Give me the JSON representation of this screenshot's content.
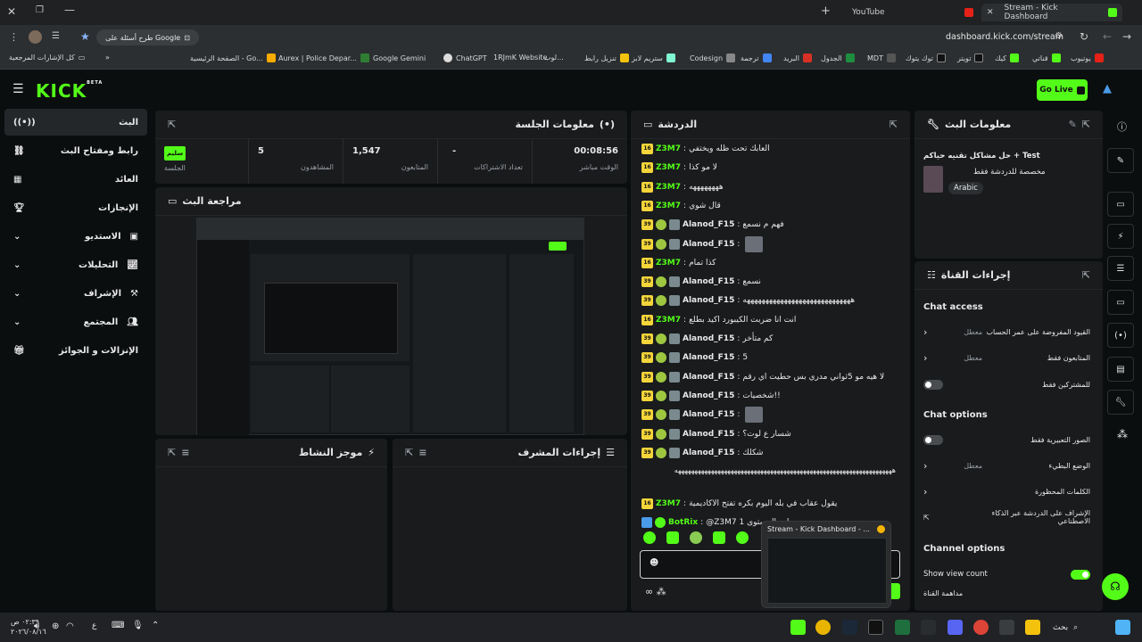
{
  "browser": {
    "tabs": [
      {
        "title": "YouTube"
      },
      {
        "title": "Stream - Kick Dashboard"
      }
    ],
    "url": "dashboard.kick.com/stream",
    "google_chip": "طرح أسئلة على Google",
    "bookmarks": [
      "يوتيوب",
      "قناتي",
      "كيك",
      "تويتر",
      "توك يتوك",
      "MDT",
      "الجدول",
      "البريد",
      "ترجمة",
      "Codesign",
      "ستريم لابز",
      "تنزيل رابط",
      "لوب...",
      "1RJmK Website",
      "ChatGPT",
      "Google Gemini",
      "Aurex | Police Depar...",
      "الصفحة الرئيسية - Go...",
      "كل الإشارات المرجعية"
    ],
    "colors": {
      "accent": "#53fc18"
    }
  },
  "kick": {
    "logo": "KICK",
    "logo_sup": "BETA",
    "go_live": "Go Live"
  },
  "sidebar": {
    "items": [
      {
        "label": "البث"
      },
      {
        "label": "رابط ومفتاح البث"
      },
      {
        "label": "العائد"
      },
      {
        "label": "الإنجازات"
      },
      {
        "label": "الاستديو"
      },
      {
        "label": "التحليلات"
      },
      {
        "label": "الإشراف"
      },
      {
        "label": "المجتمع"
      },
      {
        "label": "الإنزالات و الجوائز"
      }
    ]
  },
  "session": {
    "title": "معلومات الجلسة",
    "stats": [
      {
        "value": "00:08:56",
        "label": "الوقت مباشر"
      },
      {
        "value": "-",
        "label": "تعداد الاشتراكات"
      },
      {
        "value": "1,547",
        "label": "المتابعون"
      },
      {
        "value": "5",
        "label": "المشاهدون"
      },
      {
        "value": "سليم",
        "label": "الجلسة"
      }
    ]
  },
  "preview": {
    "title": "مراجعة البث"
  },
  "activity": {
    "title": "موجز النشاط"
  },
  "modactions": {
    "title": "إجراءات المشرف"
  },
  "chat": {
    "title": "الدردشة",
    "messages": [
      {
        "user": "Z3M7",
        "text": "العابك تحت ظله ويختفي",
        "kind": "z"
      },
      {
        "user": "Z3M7",
        "text": "لا مو كذا",
        "kind": "z"
      },
      {
        "user": "Z3M7",
        "text": "ههههههههه",
        "kind": "z"
      },
      {
        "user": "Z3M7",
        "text": "قال شوي",
        "kind": "z"
      },
      {
        "user": "Alanod_F15",
        "text": "فهم م نسمع",
        "kind": "a"
      },
      {
        "user": "Alanod_F15",
        "text": "",
        "kind": "a"
      },
      {
        "user": "Z3M7",
        "text": "كذا تمام",
        "kind": "z"
      },
      {
        "user": "Alanod_F15",
        "text": "نسمع",
        "kind": "a"
      },
      {
        "user": "Alanod_F15",
        "text": "هههههههههههههههههههههههههههههه",
        "kind": "a"
      },
      {
        "user": "Z3M7",
        "text": "انت انا ضربت الكيبورد اكيد بطلع",
        "kind": "z"
      },
      {
        "user": "Alanod_F15",
        "text": "كم متأخر",
        "kind": "a"
      },
      {
        "user": "Alanod_F15",
        "text": "5",
        "kind": "a"
      },
      {
        "user": "Alanod_F15",
        "text": "لا هيه مو 5ثواني مدري بس حطيت اي رقم",
        "kind": "a"
      },
      {
        "user": "Alanod_F15",
        "text": "شخصيات!!",
        "kind": "a"
      },
      {
        "user": "Alanod_F15",
        "text": "",
        "kind": "a"
      },
      {
        "user": "Alanod_F15",
        "text": "شسار ع لوت؟",
        "kind": "a"
      },
      {
        "user": "Alanod_F15",
        "text": "شكلك",
        "kind": "a"
      }
    ],
    "long_line": "ههههههههههههههههههههههههههههههههههههههههههههههههههههههههههههههههههه",
    "last_z": {
      "user": "Z3M7",
      "text": "يقول عقاب في بله اليوم بكره تفتح الاكاديمية"
    },
    "bot": {
      "user": "BotRix",
      "text": "@Z3M7 وصلت المستوى 1"
    },
    "hover_title": "Stream - Kick Dashboard - ..."
  },
  "stream_info": {
    "title": "معلومات البث",
    "stream_title": "حل مشاكل تقنيه حياكم + Test",
    "subtitle": "مخصصة للدردشة فقط",
    "language": "Arabic"
  },
  "channel_actions": {
    "title": "إجراءات القناة",
    "chat_access_h": "Chat access",
    "chat_options_h": "Chat options",
    "channel_options_h": "Channel options",
    "rows": [
      {
        "label": "القيود المفروضة على عمر الحساب",
        "value": "معطل",
        "type": "chevron"
      },
      {
        "label": "المتابعون فقط",
        "value": "معطل",
        "type": "chevron"
      },
      {
        "label": "للمشتركين فقط",
        "value": "",
        "type": "toggle",
        "on": false
      },
      {
        "label": "الصور التعبيرية فقط",
        "value": "",
        "type": "toggle",
        "on": false
      },
      {
        "label": "الوضع البطيء",
        "value": "معطل",
        "type": "chevron"
      },
      {
        "label": "الكلمات المحظورة",
        "value": "",
        "type": "chevron"
      },
      {
        "label": "الإشراف على الدردشة عبر الذكاء الاصطناعي",
        "value": "",
        "type": "external"
      }
    ],
    "show_view_count": "Show view count",
    "show_view_count_on": true,
    "channel_host": "مداهمة القناة"
  },
  "taskbar": {
    "time": "٠٢:٣٩ ص",
    "date": "٢٠٢٦/٠٨/١٦",
    "search": "بحث",
    "lang": "ع"
  }
}
